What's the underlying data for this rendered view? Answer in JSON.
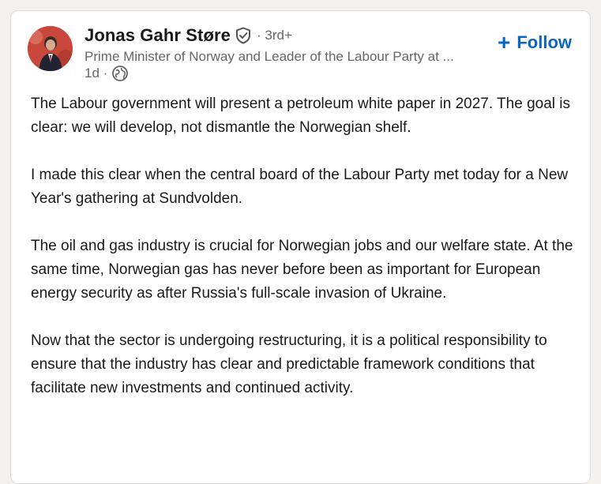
{
  "author": {
    "name": "Jonas Gahr Støre",
    "connection": "3rd+",
    "headline": "Prime Minister of Norway and Leader of the Labour Party at ...",
    "time": "1d",
    "visibility_icon": "globe-icon",
    "verified_icon": "verified-badge-icon"
  },
  "actions": {
    "follow_label": "Follow",
    "follow_icon": "+"
  },
  "post": {
    "paragraphs": [
      "The Labour government will present a petroleum white paper in 2027. The goal is clear: we will develop, not dismantle the Norwegian shelf.",
      "I made this clear when the central board of the Labour Party met today for a New Year's gathering at Sundvolden.",
      "The oil and gas industry is crucial for Norwegian jobs and our welfare state. At the same time, Norwegian gas has never before been as important for European energy security as after Russia's full-scale invasion of Ukraine.",
      "Now that the sector is undergoing restructuring, it is a political responsibility to ensure that the industry has clear and predictable framework conditions that facilitate new investments and continued activity."
    ]
  },
  "colors": {
    "accent": "#0a66c2",
    "secondary_text": "#666666",
    "avatar_bg": "#c9483b"
  }
}
